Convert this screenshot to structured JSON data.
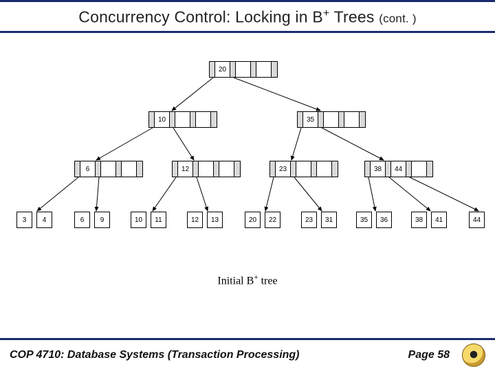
{
  "title": {
    "main_prefix": "Concurrency Control: Locking in B",
    "superscript": "+",
    "main_suffix": " Trees",
    "cont": "(cont. )"
  },
  "tree": {
    "root": {
      "keys": [
        "20"
      ]
    },
    "level1": [
      {
        "keys": [
          "10"
        ]
      },
      {
        "keys": [
          "35"
        ]
      }
    ],
    "level2": [
      {
        "keys": [
          "6"
        ]
      },
      {
        "keys": [
          "12"
        ]
      },
      {
        "keys": [
          "23"
        ]
      },
      {
        "keys": [
          "38",
          "44"
        ]
      }
    ],
    "leaves": [
      [
        "3",
        "4"
      ],
      [
        "6",
        "9"
      ],
      [
        "10",
        "11"
      ],
      [
        "12",
        "13"
      ],
      [
        "20",
        "22"
      ],
      [
        "23",
        "31"
      ],
      [
        "35",
        "36"
      ],
      [
        "38",
        "41"
      ],
      [
        "44"
      ]
    ]
  },
  "caption": {
    "prefix": "Initial B",
    "sup": "+",
    "suffix": " tree"
  },
  "footer": {
    "course": "COP 4710: Database Systems  (Transaction Processing)",
    "page": "Page 58"
  }
}
